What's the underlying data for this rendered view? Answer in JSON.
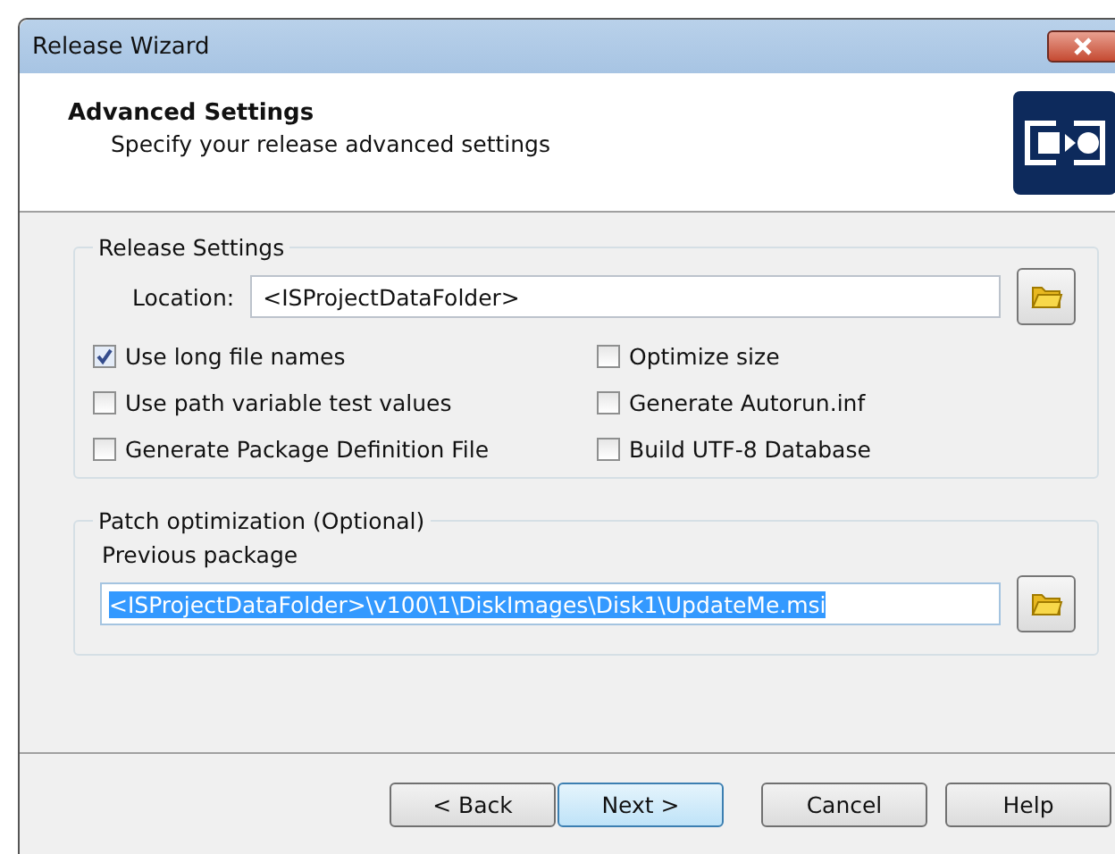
{
  "window": {
    "title": "Release Wizard"
  },
  "header": {
    "title": "Advanced Settings",
    "subtitle": "Specify your release advanced settings"
  },
  "release_settings": {
    "legend": "Release Settings",
    "location_label": "Location:",
    "location_value": "<ISProjectDataFolder>",
    "options": [
      {
        "label": "Use long file names",
        "checked": true
      },
      {
        "label": "Optimize size",
        "checked": false
      },
      {
        "label": "Use path variable test values",
        "checked": false
      },
      {
        "label": "Generate Autorun.inf",
        "checked": false
      },
      {
        "label": "Generate Package Definition File",
        "checked": false
      },
      {
        "label": "Build UTF-8 Database",
        "checked": false
      }
    ]
  },
  "patch_optimization": {
    "legend": "Patch optimization (Optional)",
    "previous_label": "Previous package",
    "previous_value": "<ISProjectDataFolder>\\v100\\1\\DiskImages\\Disk1\\UpdateMe.msi",
    "selected": true
  },
  "buttons": [
    {
      "label": "< Back",
      "default": false
    },
    {
      "label": "Next >",
      "default": true
    },
    {
      "label": "Cancel",
      "default": false
    },
    {
      "label": "Help",
      "default": false
    }
  ]
}
